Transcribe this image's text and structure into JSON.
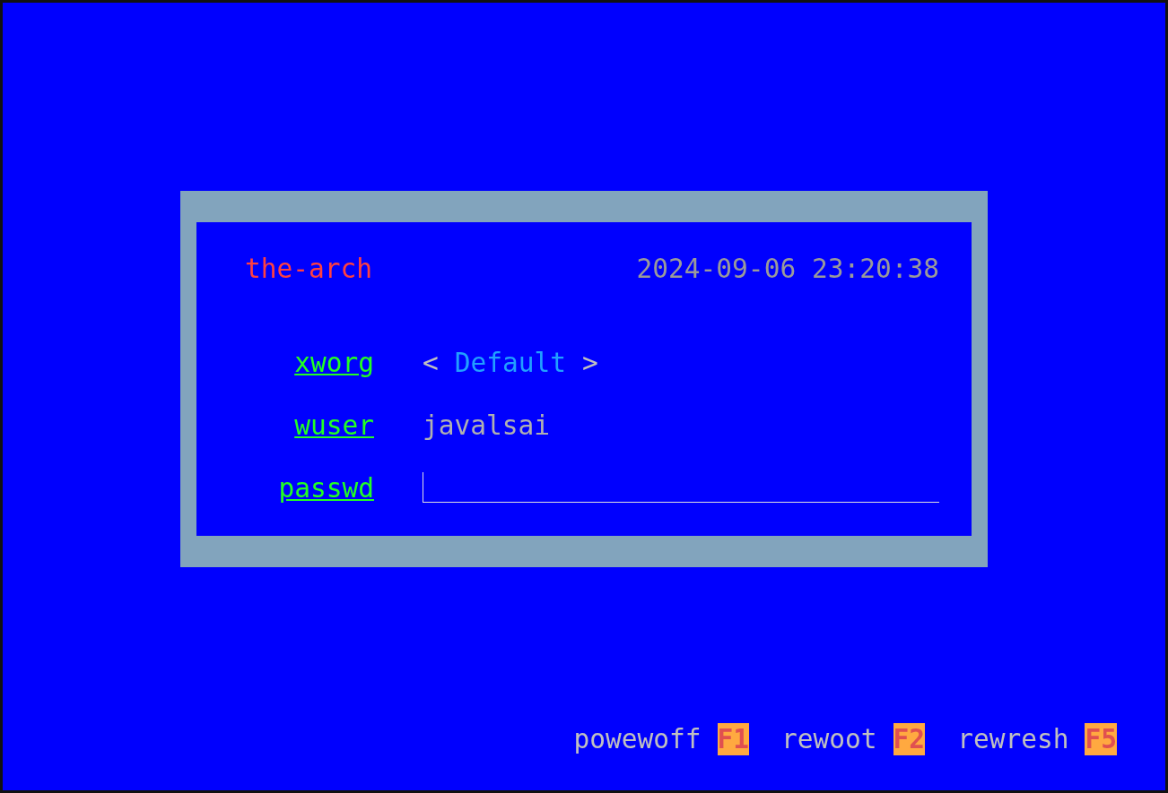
{
  "login": {
    "hostname": "the-arch",
    "datetime": "2024-09-06 23:20:38",
    "fields": [
      {
        "label": "xworg",
        "kind": "selector",
        "prev": "<",
        "value": "Default",
        "next": ">"
      },
      {
        "label": "wuser",
        "kind": "text",
        "value": "javalsai"
      },
      {
        "label": "passwd",
        "kind": "password",
        "focused": true
      }
    ]
  },
  "footer": [
    {
      "label": "powewoff",
      "key": "F1"
    },
    {
      "label": "rewoot",
      "key": "F2"
    },
    {
      "label": "rewresh",
      "key": "F5"
    }
  ]
}
